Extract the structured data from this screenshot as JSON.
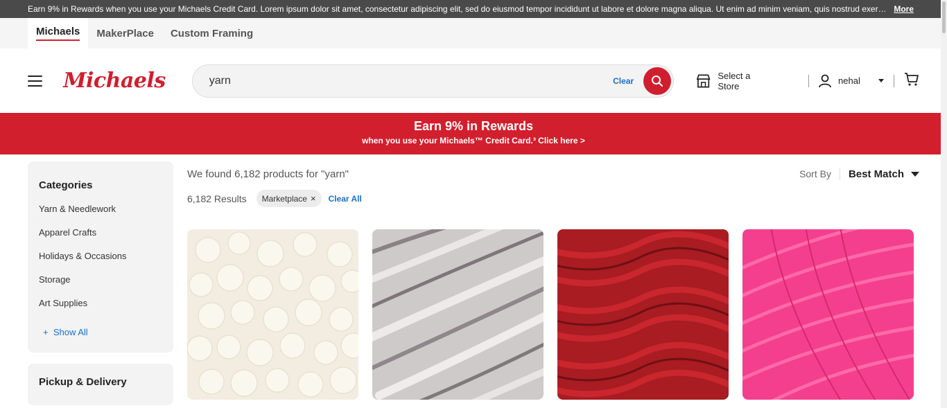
{
  "topbar": {
    "message": "Earn 9% in Rewards when you use your Michaels Credit Card. Lorem ipsum dolor sit amet, consectetur adipiscing elit, sed do eiusmod tempor incididunt ut labore et dolore magna aliqua. Ut enim ad minim veniam, quis nostrud exercitation",
    "more": "More"
  },
  "site_tabs": [
    {
      "label": "Michaels"
    },
    {
      "label": "MakerPlace"
    },
    {
      "label": "Custom Framing"
    }
  ],
  "header": {
    "logo": "Michaels",
    "search_value": "yarn",
    "clear": "Clear",
    "store": "Select a Store",
    "user": "nehal"
  },
  "promo": {
    "title": "Earn 9% in Rewards",
    "subtitle": "when you use your Michaels™ Credit Card.³ Click here >"
  },
  "sidebar": {
    "categories_title": "Categories",
    "categories": [
      {
        "label": "Yarn & Needlework"
      },
      {
        "label": "Apparel Crafts"
      },
      {
        "label": "Holidays & Occasions"
      },
      {
        "label": "Storage"
      },
      {
        "label": "Art Supplies"
      }
    ],
    "show_all": "Show All",
    "pickup_title": "Pickup & Delivery"
  },
  "results": {
    "found": "We found 6,182 products for \"yarn\"",
    "count": "6,182 Results",
    "filter_chip": "Marketplace",
    "clear_all": "Clear All",
    "sort_label": "Sort By",
    "sort_value": "Best Match"
  },
  "colors": {
    "brand": "#cf1f2f",
    "link": "#1a6fc4"
  },
  "products": [
    {
      "image": "cream-fluffy-yarn"
    },
    {
      "image": "gray-variegated-yarn"
    },
    {
      "image": "red-chunky-yarn"
    },
    {
      "image": "pink-yarn"
    }
  ]
}
